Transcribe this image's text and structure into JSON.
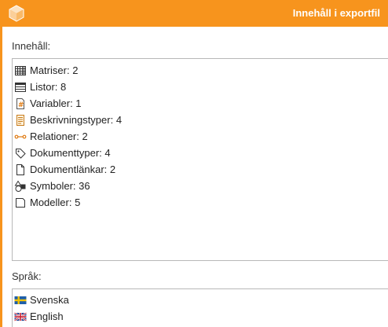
{
  "window": {
    "title": "Innehåll i exportfil",
    "accent_color": "#f7941d"
  },
  "content": {
    "label": "Innehåll:",
    "items": [
      {
        "icon": "table-grid-icon",
        "name": "Matriser",
        "count": "2"
      },
      {
        "icon": "list-icon",
        "name": "Listor",
        "count": "8"
      },
      {
        "icon": "variable-document-icon",
        "name": "Variabler",
        "count": "1"
      },
      {
        "icon": "description-document-icon",
        "name": "Beskrivningstyper",
        "count": "4"
      },
      {
        "icon": "relation-link-icon",
        "name": "Relationer",
        "count": "2"
      },
      {
        "icon": "tag-icon",
        "name": "Dokumenttyper",
        "count": "4"
      },
      {
        "icon": "blank-document-icon",
        "name": "Dokumentlänkar",
        "count": "2"
      },
      {
        "icon": "shapes-symbols-icon",
        "name": "Symboler",
        "count": "36"
      },
      {
        "icon": "model-page-icon",
        "name": "Modeller",
        "count": "5"
      }
    ]
  },
  "languages": {
    "label": "Språk:",
    "items": [
      {
        "icon": "swedish-flag-icon",
        "name": "Svenska"
      },
      {
        "icon": "uk-flag-icon",
        "name": "English"
      }
    ]
  }
}
